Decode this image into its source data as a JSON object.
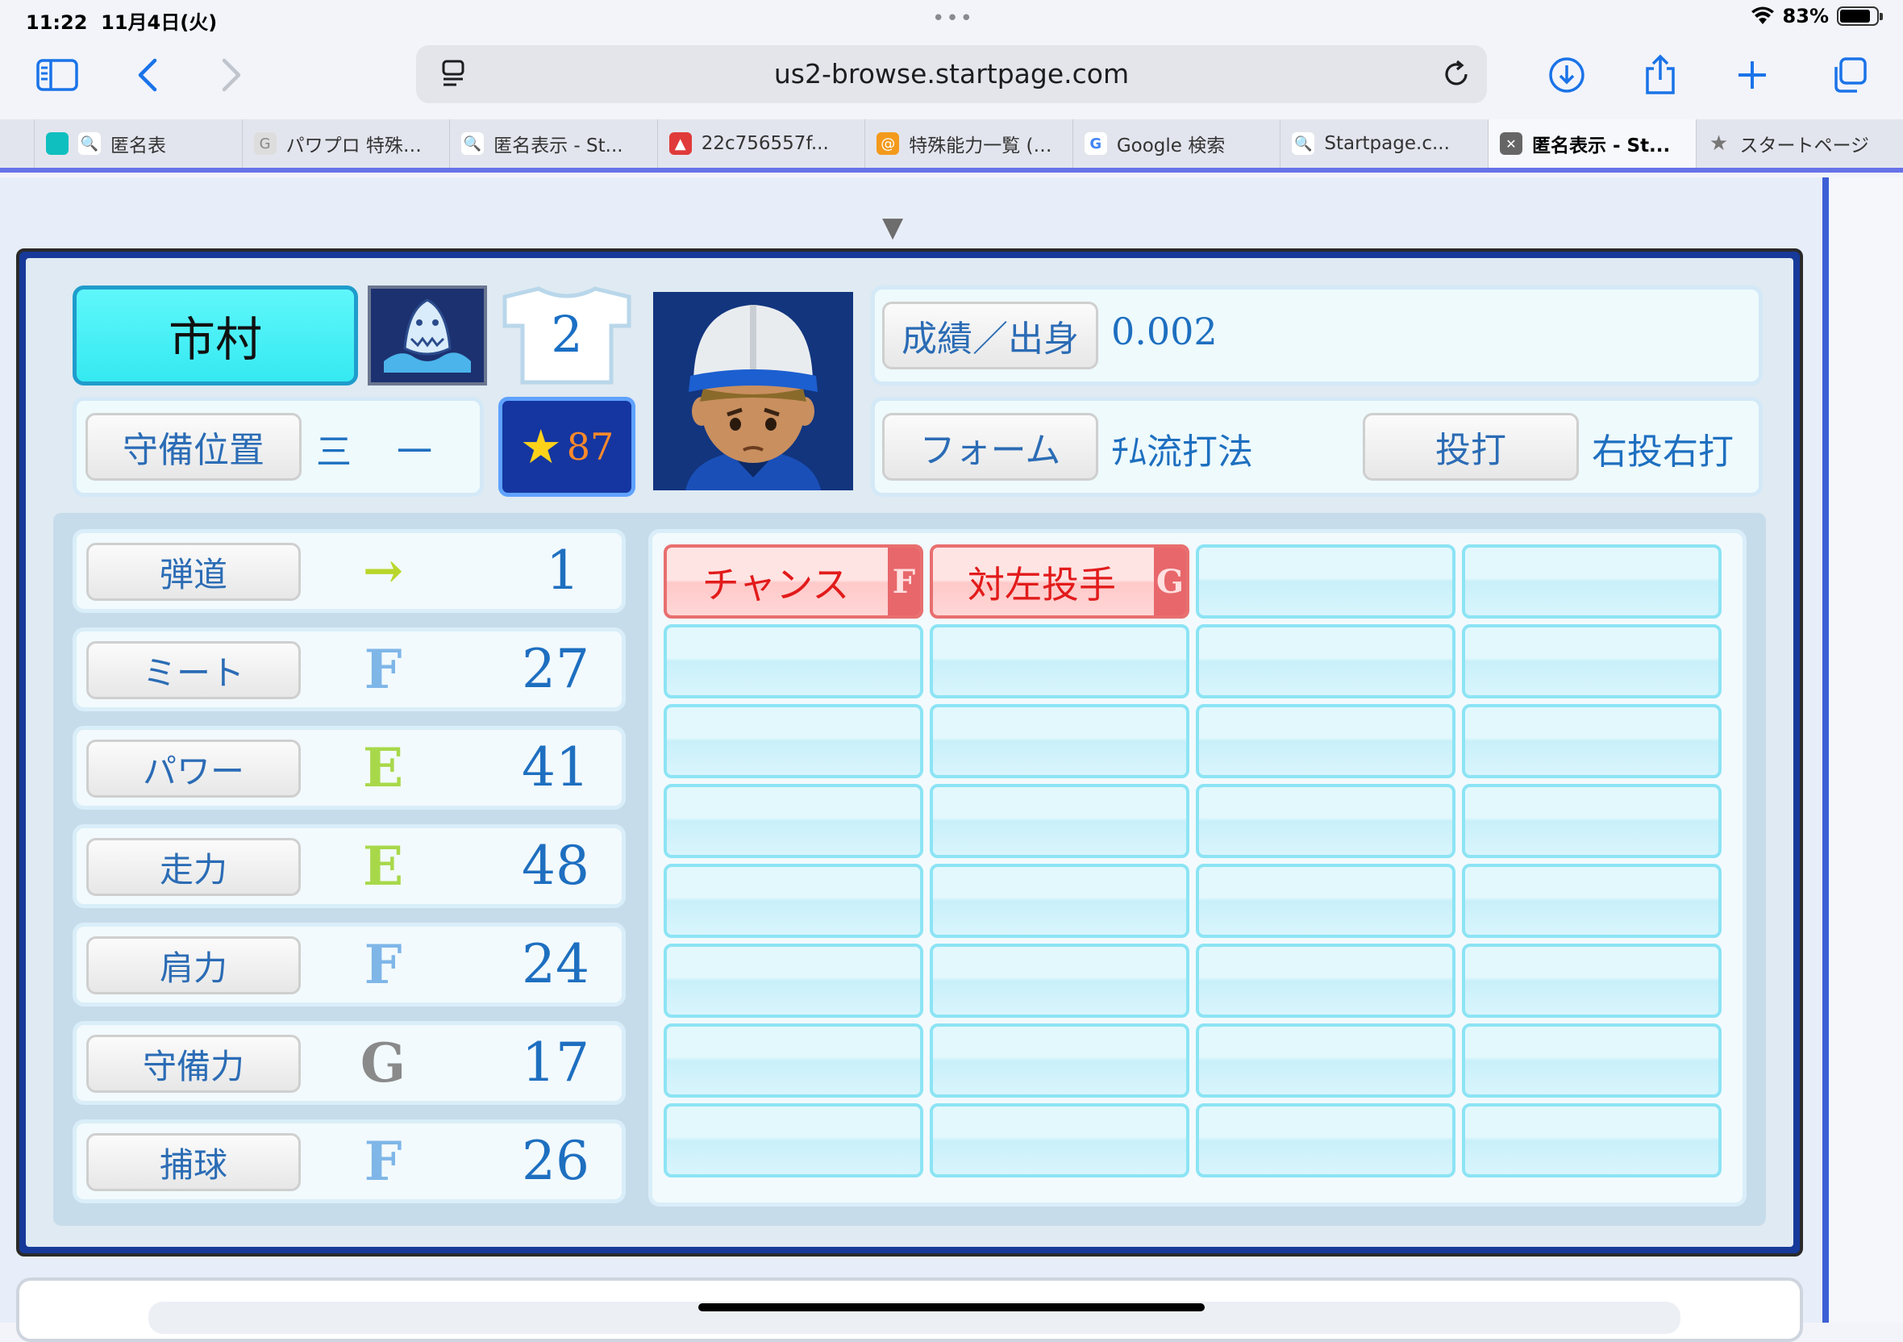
{
  "status_bar": {
    "time": "11:22",
    "date": "11月4日(火)",
    "battery_percent": "83%",
    "battery_level": 0.83
  },
  "browser": {
    "url": "us2-browse.startpage.com",
    "tabs": [
      {
        "label": "匿名表",
        "active": false
      },
      {
        "label": "パワプロ 特殊…",
        "active": false
      },
      {
        "label": "匿名表示 - St...",
        "active": false
      },
      {
        "label": "22c756557f...",
        "active": false
      },
      {
        "label": "特殊能力一覧 (…",
        "active": false
      },
      {
        "label": "Google 検索",
        "active": false
      },
      {
        "label": "Startpage.c...",
        "active": false
      },
      {
        "label": "匿名表示 - St...",
        "active": true
      },
      {
        "label": "スタートページ",
        "active": false
      }
    ]
  },
  "player": {
    "name": "市村",
    "number": "2",
    "rank": "87",
    "record_label": "成績／出身",
    "record_value": "0.002",
    "position_label": "守備位置",
    "position_value": "三　一",
    "form_label": "フォーム",
    "form_value": "ﾁﾑ流打法",
    "throw_bat_label": "投打",
    "throw_bat_value": "右投右打"
  },
  "stats": [
    {
      "label": "弾道",
      "grade": "→",
      "value": "1"
    },
    {
      "label": "ミート",
      "grade": "F",
      "value": "27"
    },
    {
      "label": "パワー",
      "grade": "E",
      "value": "41"
    },
    {
      "label": "走力",
      "grade": "E",
      "value": "48"
    },
    {
      "label": "肩力",
      "grade": "F",
      "value": "24"
    },
    {
      "label": "守備力",
      "grade": "G",
      "value": "17"
    },
    {
      "label": "捕球",
      "grade": "F",
      "value": "26"
    }
  ],
  "abilities": [
    {
      "name": "チャンス",
      "grade": "F"
    },
    {
      "name": "対左投手",
      "grade": "G"
    }
  ],
  "colors": {
    "grade_F": "#7fb6e8",
    "grade_E": "#a8d84a",
    "grade_G": "#8a8a8a",
    "arrow": "#b9d62a",
    "accent": "#1a73e8"
  }
}
